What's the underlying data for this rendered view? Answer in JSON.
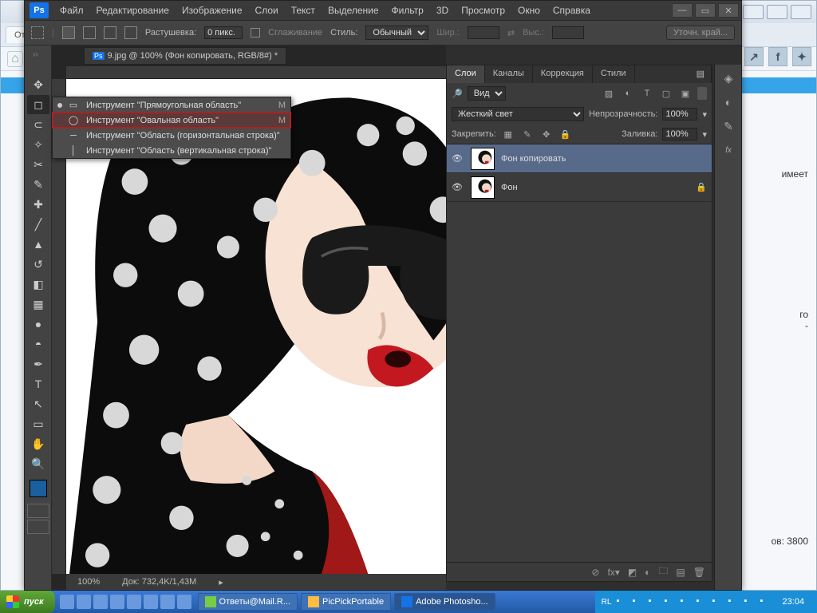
{
  "menubar": [
    "Файл",
    "Редактирование",
    "Изображение",
    "Слои",
    "Текст",
    "Выделение",
    "Фильтр",
    "3D",
    "Просмотр",
    "Окно",
    "Справка"
  ],
  "optbar": {
    "feather_label": "Растушевка:",
    "feather_val": "0 пикс.",
    "antialias": "Сглаживание",
    "style_label": "Стиль:",
    "style_val": "Обычный",
    "width_label": "Шир.:",
    "height_label": "Выс.:",
    "refine": "Уточн. край..."
  },
  "doc": {
    "tab": "9.jpg @ 100% (Фон копировать, RGB/8#) *",
    "zoom": "100%",
    "docinfo": "Док: 732,4K/1,43M"
  },
  "flyout": [
    {
      "label": "Инструмент \"Прямоугольная область\"",
      "key": "M",
      "sel": true,
      "hl": false,
      "shape": "rect"
    },
    {
      "label": "Инструмент \"Овальная область\"",
      "key": "M",
      "sel": false,
      "hl": true,
      "shape": "ellipse"
    },
    {
      "label": "Инструмент \"Область (горизонтальная строка)\"",
      "key": "",
      "sel": false,
      "hl": false,
      "shape": "hrow"
    },
    {
      "label": "Инструмент \"Область (вертикальная строка)\"",
      "key": "",
      "sel": false,
      "hl": false,
      "shape": "vrow"
    }
  ],
  "panels": {
    "tabs": [
      "Слои",
      "Каналы",
      "Коррекция",
      "Стили"
    ],
    "filter_label": "Вид",
    "blend": "Жесткий свет",
    "opacity_label": "Непрозрачность:",
    "opacity_val": "100%",
    "lock_label": "Закрепить:",
    "fill_label": "Заливка:",
    "fill_val": "100%",
    "layers": [
      {
        "name": "Фон копировать",
        "sel": true,
        "locked": false
      },
      {
        "name": "Фон",
        "sel": false,
        "locked": true
      }
    ]
  },
  "taskbar": {
    "start": "пуск",
    "btns": [
      {
        "label": "Ответы@Mail.R...",
        "act": false
      },
      {
        "label": "PicPickPortable",
        "act": false
      },
      {
        "label": "Adobe Photosho...",
        "act": true
      }
    ],
    "lang": "RL",
    "time": "23:04"
  },
  "bg": {
    "tab": "От",
    "text1": "имеет",
    "text2": "го",
    "text3": "-",
    "views": "ов: 3800"
  }
}
